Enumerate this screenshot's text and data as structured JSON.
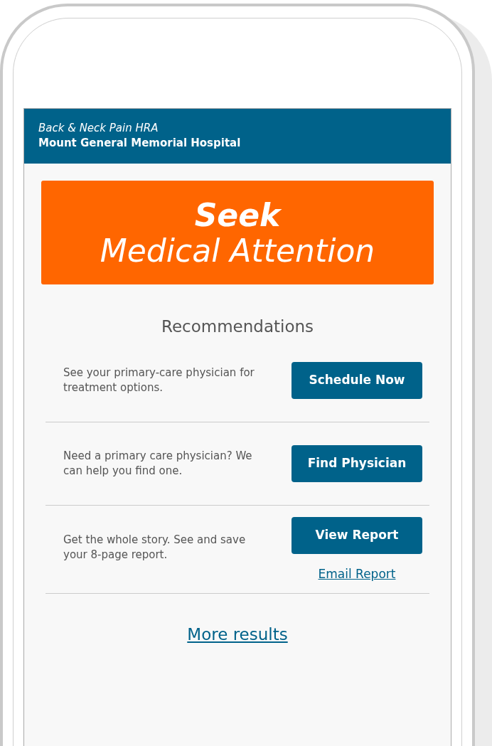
{
  "header": {
    "subtitle": "Back & Neck Pain HRA",
    "title": "Mount General Memorial Hospital"
  },
  "banner": {
    "line1": "Seek",
    "line2": "Medical Attention"
  },
  "section_title": "Recommendations",
  "recommendations": [
    {
      "text": "See your primary-care physician for treatment options.",
      "button": "Schedule Now"
    },
    {
      "text": "Need a primary care physician? We can help you find one.",
      "button": "Find Physician"
    },
    {
      "text": "Get the whole story. See and save your 8-page report.",
      "button": "View Report",
      "link": "Email Report"
    }
  ],
  "more_link": "More results"
}
